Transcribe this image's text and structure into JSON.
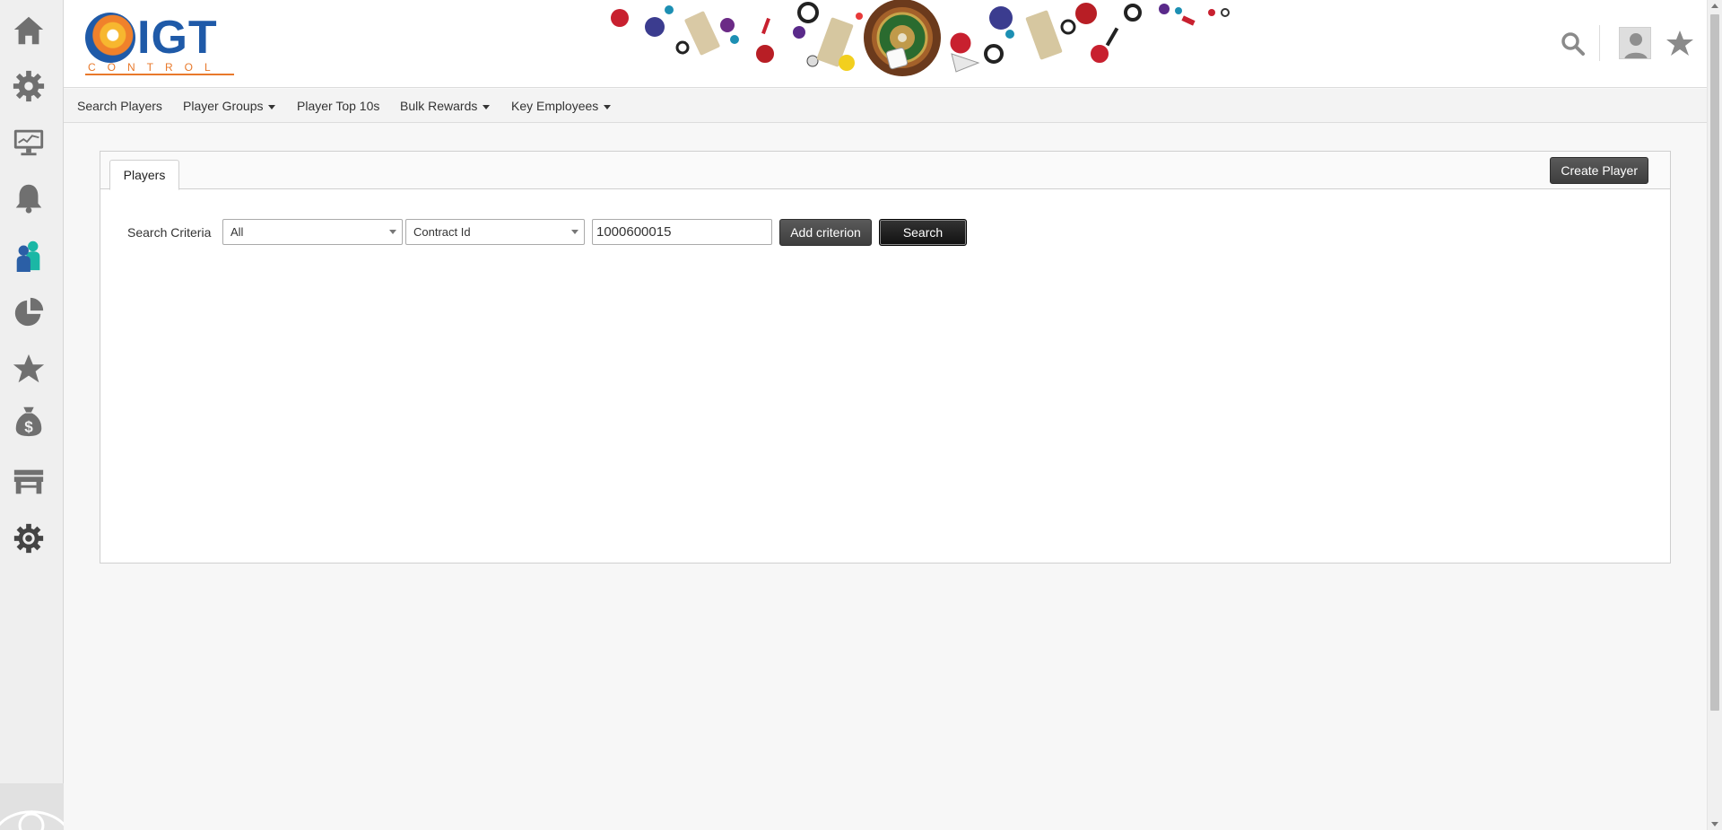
{
  "sidebar": {
    "items": [
      {
        "icon": "home-icon"
      },
      {
        "icon": "gear-icon"
      },
      {
        "icon": "monitor-icon"
      },
      {
        "icon": "bell-icon"
      },
      {
        "icon": "players-icon",
        "active": true
      },
      {
        "icon": "pie-chart-icon"
      },
      {
        "icon": "star-icon"
      },
      {
        "icon": "money-bag-icon"
      },
      {
        "icon": "store-icon"
      },
      {
        "icon": "settings-tools-icon"
      }
    ],
    "footer_icon": "eye-icon"
  },
  "header": {
    "logo_text": "IGT",
    "logo_sub": "CONTROL",
    "banner": "casino-banner",
    "search_icon": "search-icon",
    "avatar_icon": "user-avatar-icon",
    "favorite_icon": "star-icon"
  },
  "nav": {
    "items": [
      {
        "label": "Search Players",
        "dropdown": false
      },
      {
        "label": "Player Groups",
        "dropdown": true
      },
      {
        "label": "Player Top 10s",
        "dropdown": false
      },
      {
        "label": "Bulk Rewards",
        "dropdown": true
      },
      {
        "label": "Key Employees",
        "dropdown": true
      }
    ]
  },
  "panel": {
    "tab_label": "Players",
    "create_button": "Create Player",
    "criteria_label": "Search Criteria",
    "select_scope": "All",
    "select_field": "Contract Id",
    "search_value": "1000600015",
    "add_criterion_button": "Add criterion",
    "search_button": "Search"
  },
  "colors": {
    "brand_blue": "#1f5aa8",
    "brand_orange": "#e8792b",
    "active_icon_blue": "#2b5fa6",
    "active_icon_teal": "#1bb7a5"
  }
}
